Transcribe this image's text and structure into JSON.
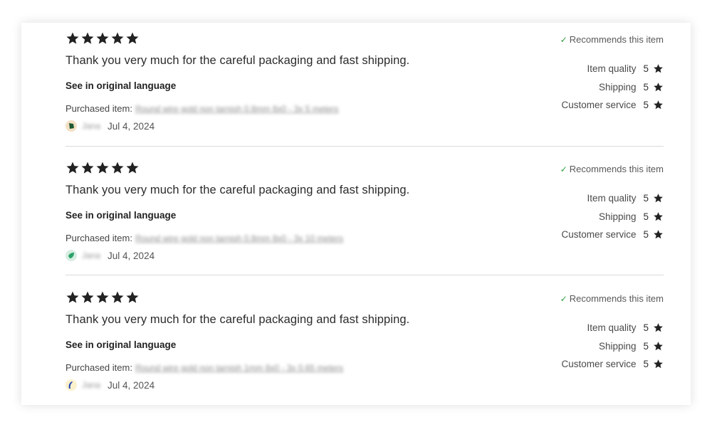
{
  "reviews": [
    {
      "rating": 5,
      "text": "Thank you very much for the careful packaging and fast shipping.",
      "see_original": "See in original language",
      "purchased_label": "Purchased item:",
      "purchased_item": "Round wire gold non tarnish 0.8mm 8x0 - 3x 5 meters",
      "reviewer_name": "Jana",
      "date": "Jul 4, 2024",
      "avatar_colors": {
        "bg": "#f3e0c4",
        "fg": "#1c5a34"
      },
      "recommends": "Recommends this item",
      "ratings": [
        {
          "label": "Item quality",
          "value": "5"
        },
        {
          "label": "Shipping",
          "value": "5"
        },
        {
          "label": "Customer service",
          "value": "5"
        }
      ]
    },
    {
      "rating": 5,
      "text": "Thank you very much for the careful packaging and fast shipping.",
      "see_original": "See in original language",
      "purchased_label": "Purchased item:",
      "purchased_item": "Round wire gold non tarnish 0.8mm 8x0 - 3x 10 meters",
      "reviewer_name": "Jana",
      "date": "Jul 4, 2024",
      "avatar_colors": {
        "bg": "#d8ede2",
        "fg": "#2aa36b"
      },
      "recommends": "Recommends this item",
      "ratings": [
        {
          "label": "Item quality",
          "value": "5"
        },
        {
          "label": "Shipping",
          "value": "5"
        },
        {
          "label": "Customer service",
          "value": "5"
        }
      ]
    },
    {
      "rating": 5,
      "text": "Thank you very much for the careful packaging and fast shipping.",
      "see_original": "See in original language",
      "purchased_label": "Purchased item:",
      "purchased_item": "Round wire gold non tarnish 1mm 8x0 - 3x 0.65 meters",
      "reviewer_name": "Jana",
      "date": "Jul 4, 2024",
      "avatar_colors": {
        "bg": "#fbf1cc",
        "fg": "#2344b8"
      },
      "recommends": "Recommends this item",
      "ratings": [
        {
          "label": "Item quality",
          "value": "5"
        },
        {
          "label": "Shipping",
          "value": "5"
        },
        {
          "label": "Customer service",
          "value": "5"
        }
      ]
    }
  ],
  "colors": {
    "star": "#222222",
    "check": "#2e9e3e",
    "divider": "#d9d9d9"
  },
  "icons": {
    "star": "star-icon",
    "check": "checkmark-icon"
  }
}
